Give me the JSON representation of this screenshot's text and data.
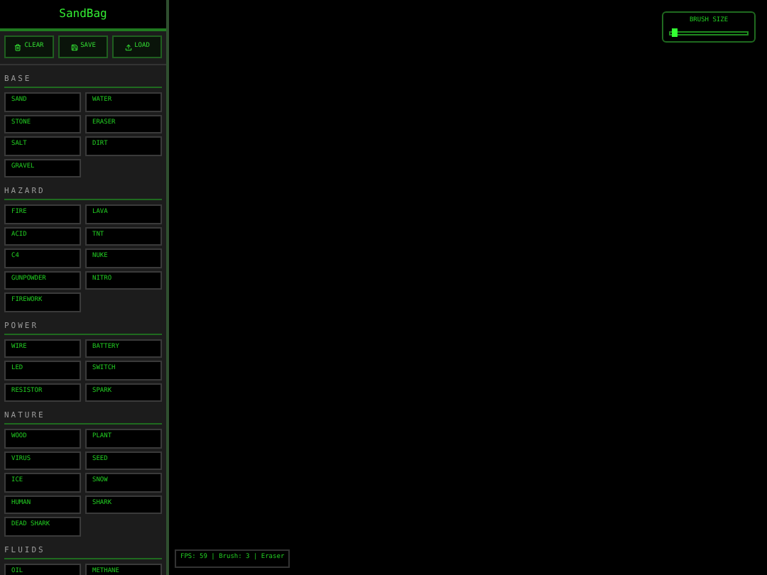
{
  "app_title": "SandBag",
  "actions": [
    {
      "kind": "clear",
      "label": "CLEAR"
    },
    {
      "kind": "save",
      "label": "SAVE"
    },
    {
      "kind": "load",
      "label": "LOAD"
    }
  ],
  "sections": [
    {
      "title": "BASE",
      "items": [
        "SAND",
        "WATER",
        "STONE",
        "ERASER",
        "SALT",
        "DIRT",
        "GRAVEL"
      ]
    },
    {
      "title": "HAZARD",
      "items": [
        "FIRE",
        "LAVA",
        "ACID",
        "TNT",
        "C4",
        "NUKE",
        "GUNPOWDER",
        "NITRO",
        "FIREWORK"
      ]
    },
    {
      "title": "POWER",
      "items": [
        "WIRE",
        "BATTERY",
        "LED",
        "SWITCH",
        "RESISTOR",
        "SPARK"
      ]
    },
    {
      "title": "NATURE",
      "items": [
        "WOOD",
        "PLANT",
        "VIRUS",
        "SEED",
        "ICE",
        "SNOW",
        "HUMAN",
        "SHARK",
        "DEAD SHARK"
      ]
    },
    {
      "title": "FLUIDS",
      "items": [
        "OIL",
        "METHANE"
      ]
    }
  ],
  "brush": {
    "label": "BRUSH SIZE",
    "level": 0.08
  },
  "status": "FPS: 59 | Brush: 3 | Eraser"
}
